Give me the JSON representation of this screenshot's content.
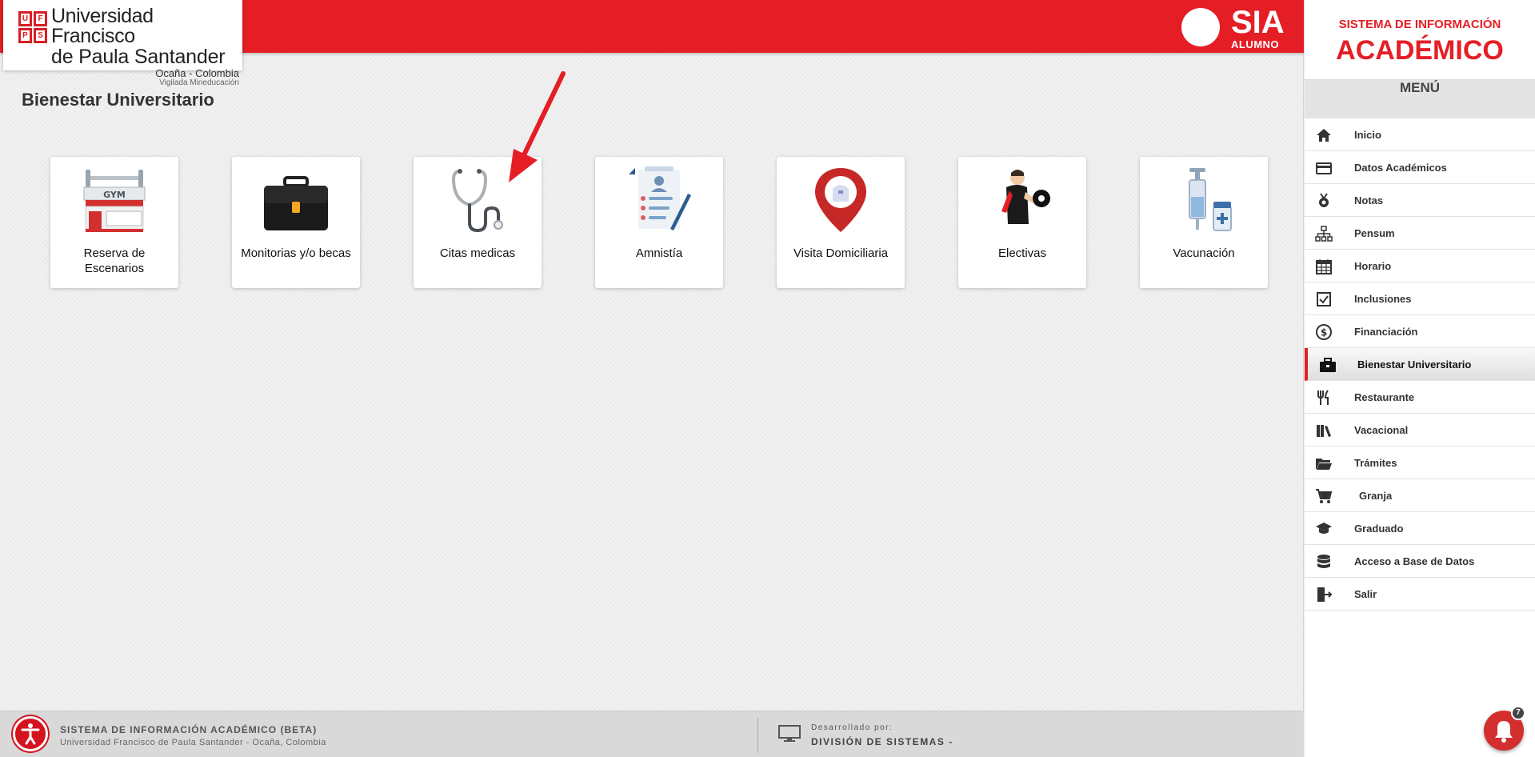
{
  "header": {
    "university_line1": "Universidad Francisco",
    "university_line2": "de Paula Santander",
    "university_line3": "Ocaña - Colombia",
    "university_line4": "Vigilada Mineducación",
    "logo_letters": [
      "U",
      "F",
      "P",
      "S"
    ],
    "sia_title": "SIA",
    "sia_subtitle": "ALUMNO"
  },
  "page": {
    "title": "Bienestar Universitario"
  },
  "cards": [
    {
      "label": "Reserva de Escenarios",
      "icon": "gym-icon"
    },
    {
      "label": "Monitorias y/o becas",
      "icon": "briefcase-icon"
    },
    {
      "label": "Citas medicas",
      "icon": "stethoscope-icon"
    },
    {
      "label": "Amnistía",
      "icon": "document-icon"
    },
    {
      "label": "Visita Domiciliaria",
      "icon": "map-pin-icon"
    },
    {
      "label": "Electivas",
      "icon": "athlete-icon"
    },
    {
      "label": "Vacunación",
      "icon": "syringe-icon"
    }
  ],
  "sidebar": {
    "header_line1": "SISTEMA DE INFORMACIÓN",
    "header_line2": "ACADÉMICO",
    "menu_title": "MENÚ",
    "items": [
      {
        "label": "Inicio",
        "icon": "home-icon"
      },
      {
        "label": "Datos Académicos",
        "icon": "card-icon"
      },
      {
        "label": "Notas",
        "icon": "medal-icon"
      },
      {
        "label": "Pensum",
        "icon": "sitemap-icon"
      },
      {
        "label": "Horario",
        "icon": "calendar-icon"
      },
      {
        "label": "Inclusiones",
        "icon": "checkbox-icon"
      },
      {
        "label": "Financiación",
        "icon": "dollar-icon"
      },
      {
        "label": "Bienestar Universitario",
        "icon": "briefcase-icon",
        "active": true
      },
      {
        "label": "Restaurante",
        "icon": "utensils-icon"
      },
      {
        "label": "Vacacional",
        "icon": "books-icon"
      },
      {
        "label": "Trámites",
        "icon": "folder-icon"
      },
      {
        "label": "Granja",
        "icon": "cart-icon"
      },
      {
        "label": "Graduado",
        "icon": "graduation-icon"
      },
      {
        "label": "Acceso a Base de Datos",
        "icon": "database-icon"
      },
      {
        "label": "Salir",
        "icon": "exit-icon"
      }
    ]
  },
  "footer": {
    "system_name": "SISTEMA DE INFORMACIÓN ACADÉMICO (BETA)",
    "system_org": "Universidad Francisco de Paula Santander - Ocaña, Colombia",
    "developed_by_label": "Desarrollado por:",
    "developed_by": "DIVISIÓN DE SISTEMAS -"
  },
  "notifications": {
    "count": "7"
  },
  "colors": {
    "brand_red": "#e51e25",
    "sidebar_bg": "#ffffff",
    "footer_bg": "#d9d9d9"
  }
}
